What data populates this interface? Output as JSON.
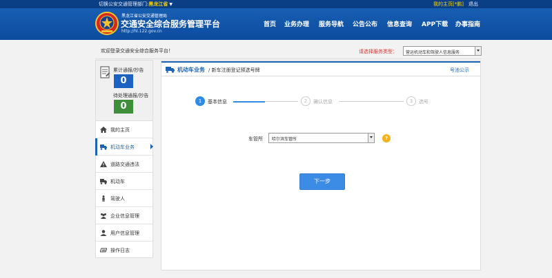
{
  "topbar": {
    "region_prefix": "切换公安交通管理部门:",
    "region_selected": "黑龙江省",
    "my_home": "我的主页[*鹏]",
    "logout": "退出"
  },
  "brand": {
    "org_name": "黑龙江省公安交通管理局",
    "platform_title": "交通安全综合服务管理平台",
    "url": "http://hl.122.gov.cn"
  },
  "nav": {
    "items": [
      "首页",
      "业务办理",
      "服务导航",
      "公告公布",
      "信息查询",
      "APP下载",
      "办事指南"
    ]
  },
  "welcome": {
    "text": "欢迎登录交通安全综合服务平台！",
    "service_label": "请选择服务类型：",
    "service_value": "营运机动车和驾驶人信息服务"
  },
  "stats": {
    "total_label": "累计通报/抄告",
    "total_count": "0",
    "pending_label": "待处理通报/抄告",
    "pending_count": "0"
  },
  "sidebar": {
    "items": [
      {
        "label": "我的主页",
        "icon": "home-icon"
      },
      {
        "label": "机动车业务",
        "icon": "truck-icon",
        "active": true
      },
      {
        "label": "道路交通违法",
        "icon": "warning-icon"
      },
      {
        "label": "机动车",
        "icon": "car-icon"
      },
      {
        "label": "驾驶人",
        "icon": "person-icon"
      },
      {
        "label": "企业信息管理",
        "icon": "group-icon"
      },
      {
        "label": "用户信息管理",
        "icon": "user-icon"
      },
      {
        "label": "操作日志",
        "icon": "log-icon"
      }
    ]
  },
  "panel": {
    "category": "机动车业务",
    "subtitle": "/ 新车注册登记预选号牌",
    "announcement": "号池公示"
  },
  "steps": [
    {
      "num": "1",
      "label": "基本信息",
      "state": "active"
    },
    {
      "num": "2",
      "label": "确认信息",
      "state": "todo"
    },
    {
      "num": "3",
      "label": "选号",
      "state": "todo"
    }
  ],
  "form": {
    "station_label": "车管所",
    "station_value": "哈尔滨车管所",
    "help_symbol": "?",
    "next_button": "下一步"
  }
}
